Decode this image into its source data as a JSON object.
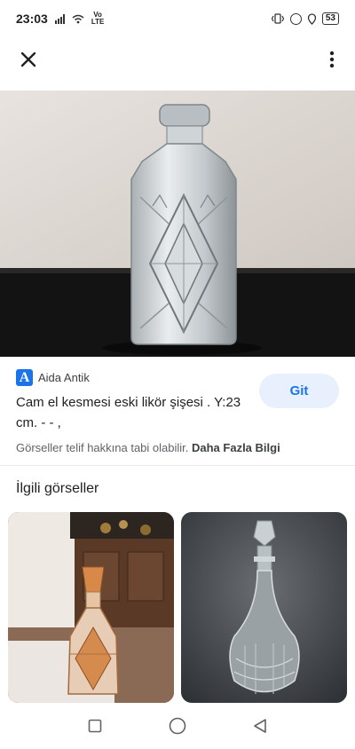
{
  "status_bar": {
    "time": "23:03",
    "network": "Vo\nLTE",
    "battery": "53"
  },
  "app_bar": {
    "close_icon": "close-icon",
    "more_icon": "more-vert-icon"
  },
  "result": {
    "source_logo_letter": "A",
    "source_name": "Aida Antik",
    "title": "Cam el kesmesi eski likör şişesi . Y:23 cm. - - ,",
    "go_label": "Git",
    "copyright_text": "Görseller telif hakkına tabi olabilir.",
    "more_info_link": "Daha Fazla Bilgi"
  },
  "related": {
    "heading": "İlgili görseller"
  },
  "nav": {
    "recents_icon": "square-icon",
    "home_icon": "circle-icon",
    "back_icon": "triangle-back-icon"
  },
  "colors": {
    "accent": "#1a73e8",
    "button_bg": "#e8f0fe"
  }
}
